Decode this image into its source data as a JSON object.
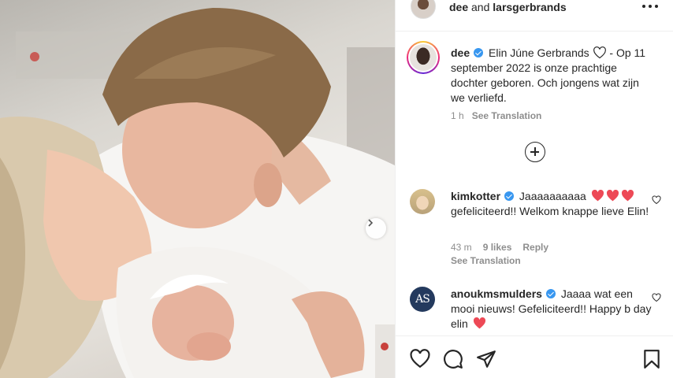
{
  "header": {
    "user1": "dee",
    "joiner": "and",
    "user2": "larsgerbrands"
  },
  "caption": {
    "username": "dee",
    "text_before_heart": "Elin Júne Gerbrands",
    "text_after_heart": " - Op 11 september 2022 is onze prachtige dochter geboren. Och jongens wat zijn we verliefd.",
    "time": "1 h",
    "see_translation": "See Translation"
  },
  "comments": [
    {
      "username": "kimkotter",
      "text": "Jaaaaaaaaaa",
      "text_after": "gefeliciteerd!! Welkom knappe lieve Elin!",
      "time": "43 m",
      "likes": "9 likes",
      "reply": "Reply",
      "see_translation": "See Translation"
    },
    {
      "username": "anoukmsmulders",
      "avatar_initials": "AS",
      "text": "Jaaaa wat een mooi nieuws! Gefeliciteerd!! Happy b day elin"
    }
  ],
  "colors": {
    "verified": "#3897f0",
    "red_heart": "#ed4956",
    "muted_text": "#8e8e8e"
  },
  "icons": [
    "more-icon",
    "plus-circle-icon",
    "heart-icon",
    "comment-icon",
    "share-icon",
    "bookmark-icon",
    "chevron-right-icon"
  ]
}
